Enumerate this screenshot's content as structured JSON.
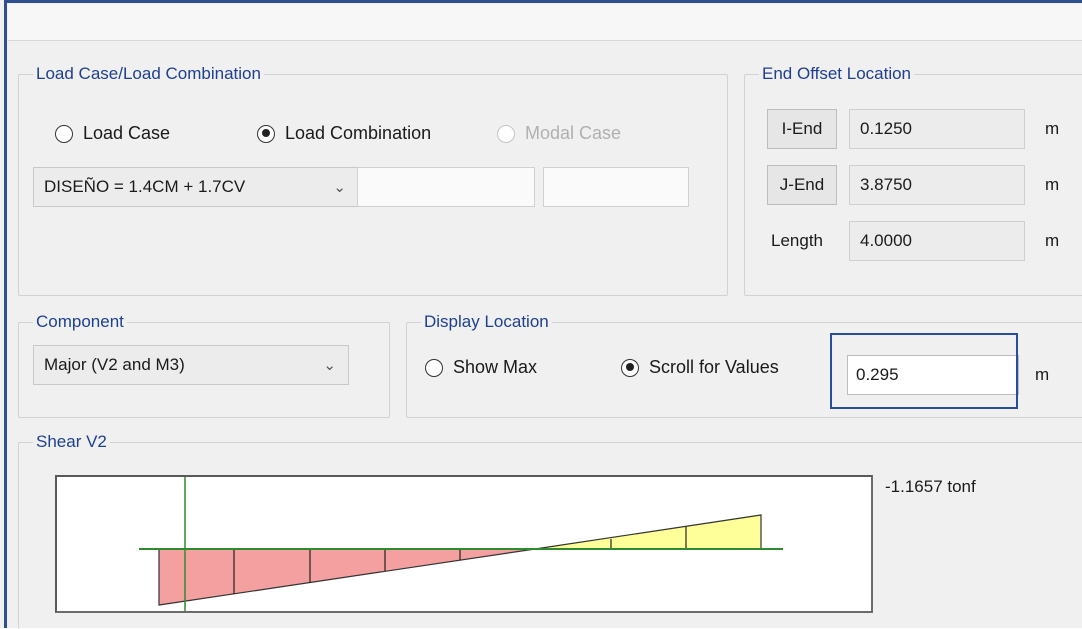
{
  "load_case": {
    "group_label": "Load Case/Load Combination",
    "radio_load_case": "Load Case",
    "radio_load_combination": "Load Combination",
    "radio_modal_case": "Modal Case",
    "selected_combination": "DISEÑO = 1.4CM + 1.7CV"
  },
  "end_offset": {
    "group_label": "End Offset Location",
    "i_end_label": "I-End",
    "i_end_value": "0.1250",
    "j_end_label": "J-End",
    "j_end_value": "3.8750",
    "length_label": "Length",
    "length_value": "4.0000",
    "unit": "m"
  },
  "component": {
    "group_label": "Component",
    "selected": "Major (V2 and M3)"
  },
  "display_location": {
    "group_label": "Display Location",
    "radio_show_max": "Show Max",
    "radio_scroll": "Scroll for Values",
    "value": "0.295",
    "unit": "m"
  },
  "shear": {
    "group_label": "Shear V2",
    "readout": "-1.1657 tonf",
    "colors": {
      "negative": "#f4a0a0",
      "positive": "#ffff99",
      "axis": "#2e8b2e",
      "cursor": "#2e8b2e"
    }
  },
  "icons": {
    "dropdown": "chevron-down-icon"
  }
}
